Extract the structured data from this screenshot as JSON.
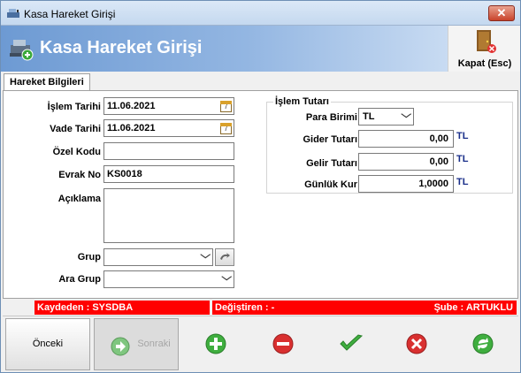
{
  "window": {
    "title": "Kasa Hareket Girişi",
    "close_glyph": "✕"
  },
  "banner": {
    "heading": "Kasa Hareket Girişi",
    "close_label": "Kapat (Esc)"
  },
  "tabs": [
    {
      "label": "Hareket Bilgileri",
      "active": true
    }
  ],
  "form": {
    "islem_tarihi": {
      "label": "İşlem Tarihi",
      "value": "11.06.2021"
    },
    "vade_tarihi": {
      "label": "Vade Tarihi",
      "value": "11.06.2021"
    },
    "ozel_kodu": {
      "label": "Özel Kodu",
      "value": ""
    },
    "evrak_no": {
      "label": "Evrak No",
      "value": "KS0018"
    },
    "aciklama": {
      "label": "Açıklama",
      "value": ""
    },
    "grup": {
      "label": "Grup",
      "value": ""
    },
    "ara_grup": {
      "label": "Ara Grup",
      "value": ""
    },
    "calendar_glyph": "7"
  },
  "islem_tutari": {
    "legend": "İşlem Tutarı",
    "para_birimi": {
      "label": "Para Birimi",
      "value": "TL"
    },
    "gider_tutari": {
      "label": "Gider Tutarı",
      "value": "0,00",
      "unit": "TL"
    },
    "gelir_tutari": {
      "label": "Gelir Tutarı",
      "value": "0,00",
      "unit": "TL"
    },
    "gunluk_kur": {
      "label": "Günlük Kur",
      "value": "1,0000",
      "unit": "TL"
    }
  },
  "status": {
    "kaydeden": "Kaydeden : SYSDBA",
    "degistiren": "Değiştiren :  -",
    "sube": "Şube : ARTUKLU"
  },
  "toolbar": {
    "previous": "Önceki",
    "next": "Sonraki"
  },
  "colors": {
    "status_red": "#ff0000",
    "banner_blue": "#6d9ad3",
    "unit_blue": "#1a2f8a"
  }
}
